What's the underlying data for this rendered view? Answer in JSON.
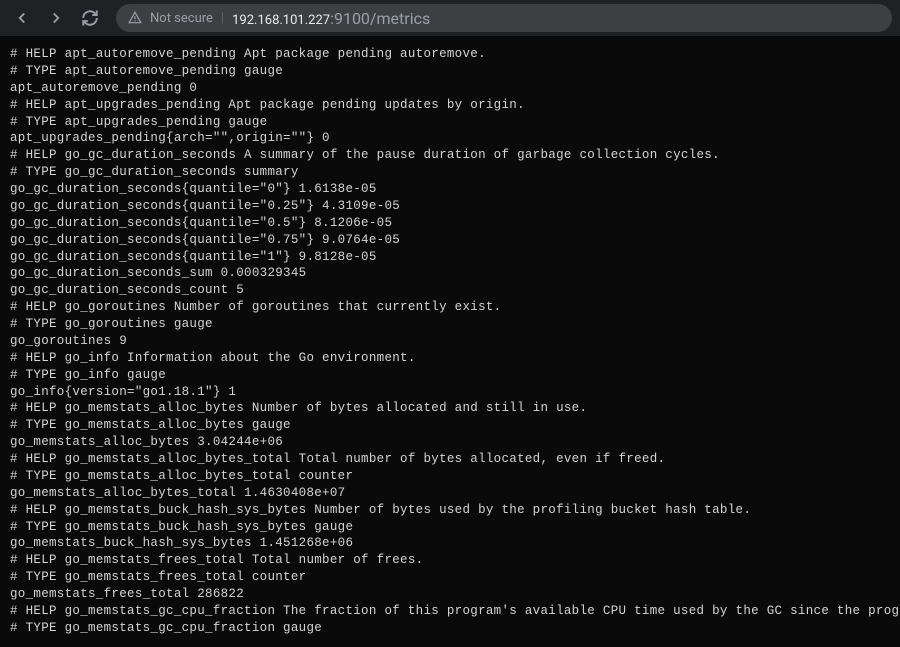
{
  "toolbar": {
    "security_text": "Not secure",
    "divider": "|",
    "url_host": "192.168.101.227",
    "url_port_path": ":9100/metrics"
  },
  "metrics": {
    "lines": [
      "# HELP apt_autoremove_pending Apt package pending autoremove.",
      "# TYPE apt_autoremove_pending gauge",
      "apt_autoremove_pending 0",
      "# HELP apt_upgrades_pending Apt package pending updates by origin.",
      "# TYPE apt_upgrades_pending gauge",
      "apt_upgrades_pending{arch=\"\",origin=\"\"} 0",
      "# HELP go_gc_duration_seconds A summary of the pause duration of garbage collection cycles.",
      "# TYPE go_gc_duration_seconds summary",
      "go_gc_duration_seconds{quantile=\"0\"} 1.6138e-05",
      "go_gc_duration_seconds{quantile=\"0.25\"} 4.3109e-05",
      "go_gc_duration_seconds{quantile=\"0.5\"} 8.1206e-05",
      "go_gc_duration_seconds{quantile=\"0.75\"} 9.0764e-05",
      "go_gc_duration_seconds{quantile=\"1\"} 9.8128e-05",
      "go_gc_duration_seconds_sum 0.000329345",
      "go_gc_duration_seconds_count 5",
      "# HELP go_goroutines Number of goroutines that currently exist.",
      "# TYPE go_goroutines gauge",
      "go_goroutines 9",
      "# HELP go_info Information about the Go environment.",
      "# TYPE go_info gauge",
      "go_info{version=\"go1.18.1\"} 1",
      "# HELP go_memstats_alloc_bytes Number of bytes allocated and still in use.",
      "# TYPE go_memstats_alloc_bytes gauge",
      "go_memstats_alloc_bytes 3.04244e+06",
      "# HELP go_memstats_alloc_bytes_total Total number of bytes allocated, even if freed.",
      "# TYPE go_memstats_alloc_bytes_total counter",
      "go_memstats_alloc_bytes_total 1.4630408e+07",
      "# HELP go_memstats_buck_hash_sys_bytes Number of bytes used by the profiling bucket hash table.",
      "# TYPE go_memstats_buck_hash_sys_bytes gauge",
      "go_memstats_buck_hash_sys_bytes 1.451268e+06",
      "# HELP go_memstats_frees_total Total number of frees.",
      "# TYPE go_memstats_frees_total counter",
      "go_memstats_frees_total 286822",
      "# HELP go_memstats_gc_cpu_fraction The fraction of this program's available CPU time used by the GC since the program started.",
      "# TYPE go_memstats_gc_cpu_fraction gauge"
    ]
  }
}
